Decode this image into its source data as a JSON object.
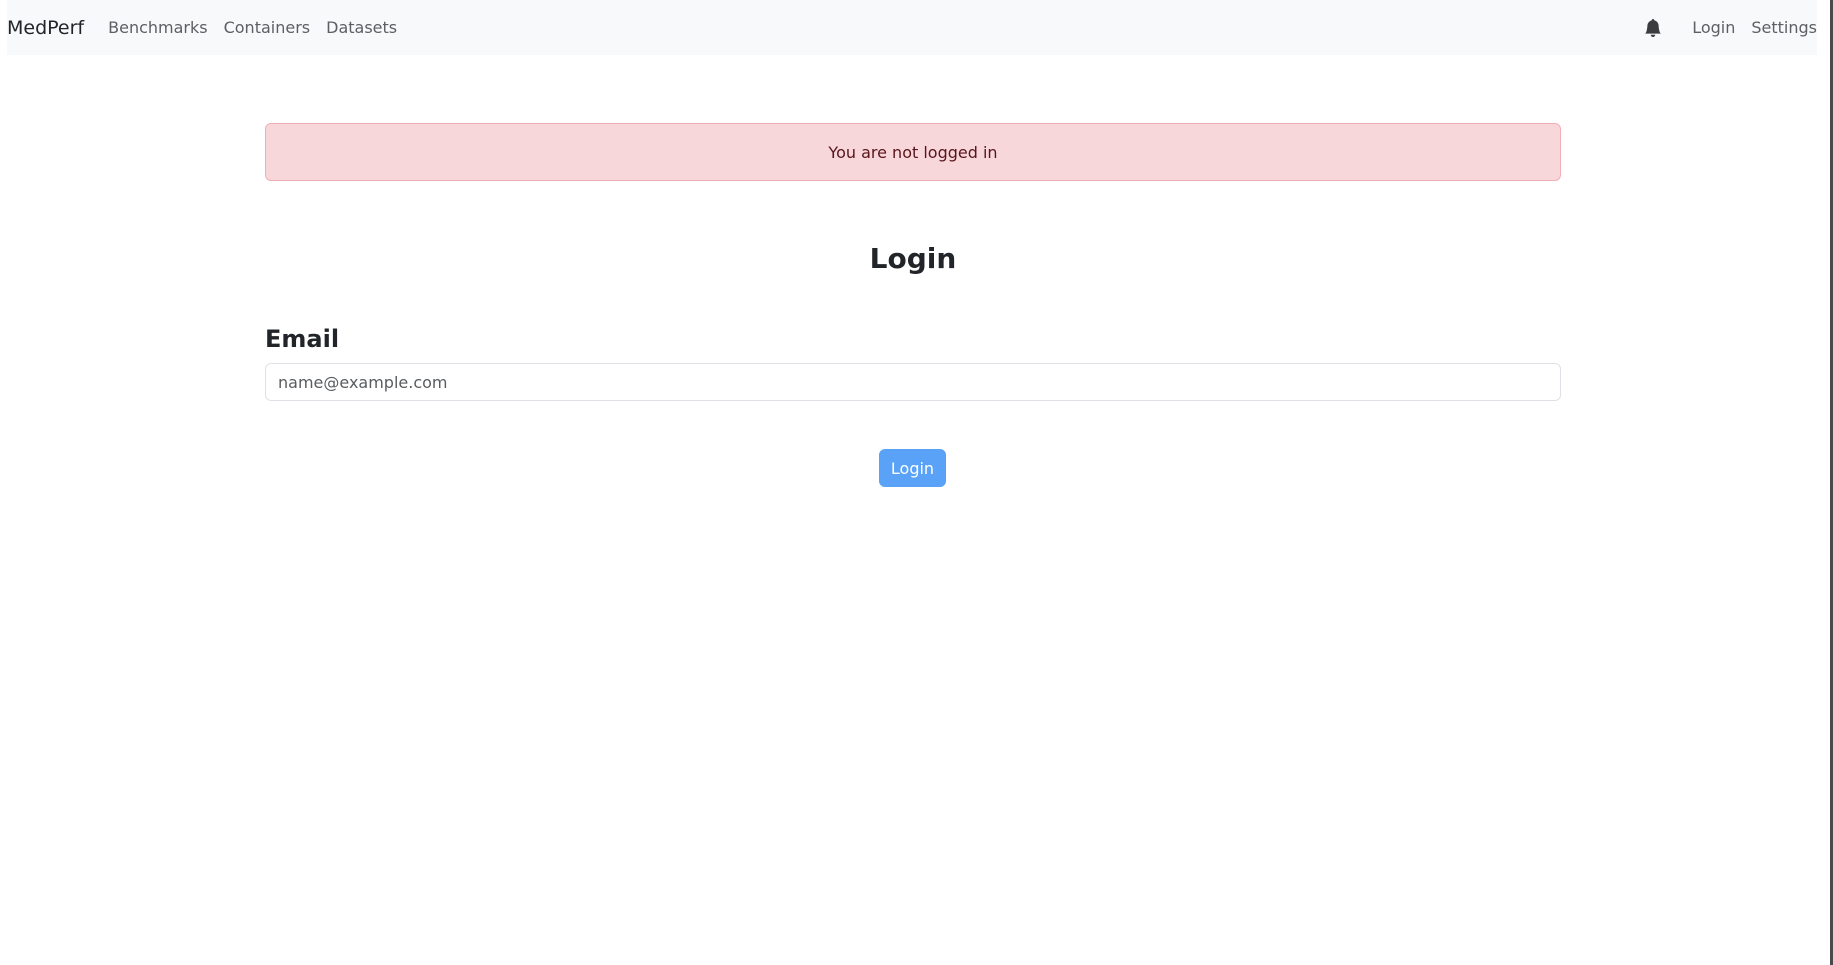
{
  "navbar": {
    "brand": "MedPerf",
    "links": [
      {
        "label": "Benchmarks"
      },
      {
        "label": "Containers"
      },
      {
        "label": "Datasets"
      }
    ],
    "right": {
      "notification_icon": "bell-icon",
      "login_label": "Login",
      "settings_label": "Settings"
    }
  },
  "alert": {
    "message": "You are not logged in",
    "background_color": "#f8d7da",
    "text_color": "#58151c"
  },
  "main": {
    "title": "Login",
    "email_label": "Email",
    "email_value": "",
    "email_placeholder": "name@example.com",
    "submit_label": "Login",
    "submit_color": "#5aa2f7"
  }
}
